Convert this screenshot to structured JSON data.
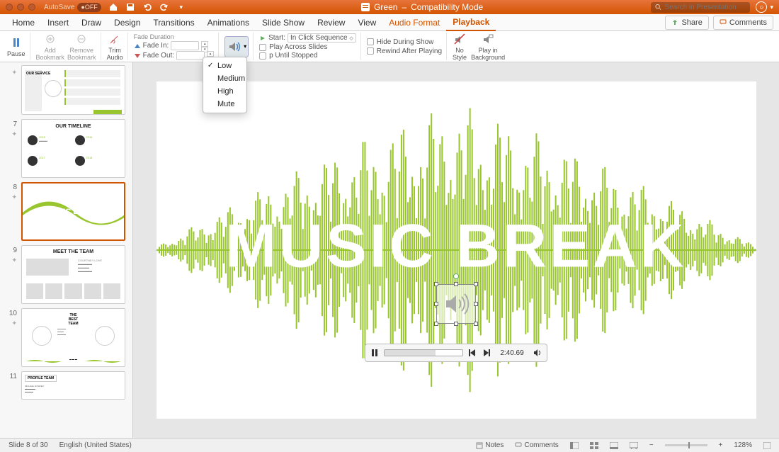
{
  "titlebar": {
    "autosave_label": "AutoSave",
    "autosave_state": "OFF",
    "doc_name": "Green",
    "mode": "Compatibility Mode",
    "search_placeholder": "Search in Presentation"
  },
  "tabs": {
    "items": [
      "Home",
      "Insert",
      "Draw",
      "Design",
      "Transitions",
      "Animations",
      "Slide Show",
      "Review",
      "View",
      "Audio Format",
      "Playback"
    ],
    "active": "Playback",
    "share": "Share",
    "comments": "Comments"
  },
  "ribbon": {
    "pause": "Pause",
    "add_bookmark": "Add\nBookmark",
    "remove_bookmark": "Remove\nBookmark",
    "trim_audio": "Trim\nAudio",
    "fade_duration": "Fade Duration",
    "fade_in": "Fade In:",
    "fade_out": "Fade Out:",
    "volume": "Volume",
    "start_label": "Start:",
    "start_value": "In Click Sequence",
    "play_across": "Play Across Slides",
    "loop": "p Until Stopped",
    "hide_during": "Hide During Show",
    "rewind": "Rewind After Playing",
    "no_style": "No\nStyle",
    "play_bg": "Play in\nBackground"
  },
  "volume_menu": {
    "items": [
      "Low",
      "Medium",
      "High",
      "Mute"
    ],
    "selected": "Low"
  },
  "thumbs": [
    {
      "num": "",
      "title": "OUR\nSERVICE",
      "type": "service"
    },
    {
      "num": "7",
      "title": "OUR TIMELINE",
      "type": "timeline"
    },
    {
      "num": "8",
      "title": "MUSIC BREAK",
      "type": "music",
      "selected": true
    },
    {
      "num": "9",
      "title": "MEET THE TEAM",
      "type": "team"
    },
    {
      "num": "10",
      "title": "THE\nBEST\nTEAM",
      "type": "bestteam"
    },
    {
      "num": "11",
      "title": "PROFILE TEAM",
      "type": "profile"
    }
  ],
  "slide": {
    "title": "MUSIC BREAK"
  },
  "player": {
    "time": "2:40.69"
  },
  "status": {
    "slide_info": "Slide 8 of 30",
    "lang": "English (United States)",
    "notes": "Notes",
    "comments": "Comments",
    "zoom": "128%"
  }
}
